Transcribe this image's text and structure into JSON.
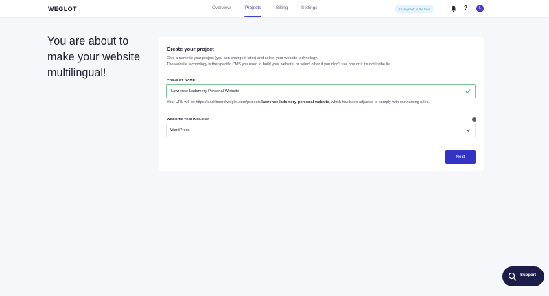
{
  "header": {
    "logo": "WEGLOT",
    "nav": [
      {
        "label": "Overview"
      },
      {
        "label": "Projects"
      },
      {
        "label": "Billing"
      },
      {
        "label": "Settings"
      }
    ],
    "active_nav": "Projects",
    "trial_badge": "14 days left in the trial",
    "help_label": "?",
    "avatar_initial": "L",
    "icons": {
      "notifications": "bell-icon",
      "help": "question-icon"
    }
  },
  "hero": {
    "line1": "You are about to",
    "line2": "make your website",
    "line3": "multilingual!"
  },
  "form": {
    "title": "Create your project",
    "description_line1": "Give a name to your project (you can change it later) and select your website technology.",
    "description_line2": "The website technology is the specific CMS you used to build your website, or select other if you didn't use one or if it's not in the list.",
    "project_name_label": "PROJECT NAME",
    "project_name_value": "Lawrence Ladomery Personal Website",
    "url_prefix": "Your URL will be https://dashboard.weglot.com/projects/",
    "url_slug": "lawrence-ladomery-personal-website",
    "url_suffix": ", which has been adjusted to comply with our naming rules.",
    "technology_label": "WEBSITE TECHNOLOGY",
    "technology_value": "WordPress",
    "next_label": "Next"
  },
  "support": {
    "label": "Support",
    "icon": "search-icon"
  },
  "colors": {
    "accent": "#3434c4",
    "valid": "#7cc596",
    "support_bg": "#1c1c48",
    "background": "#f6f7fb"
  }
}
